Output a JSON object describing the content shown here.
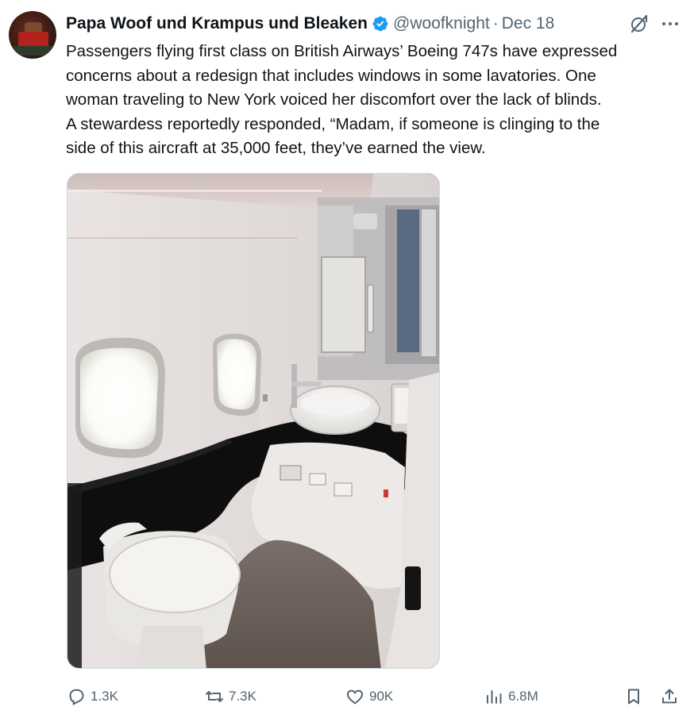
{
  "tweet": {
    "display_name": "Papa Woof und Krampus und Bleaken",
    "handle": "@woofknight",
    "separator": "·",
    "date": "Dec 18",
    "verified": true,
    "text": "Passengers flying first class on British Airways’ Boeing 747s have expressed\nconcerns about a redesign that includes windows in some lavatories. One\nwoman traveling to New York voiced her discomfort over the lack of blinds.\nA stewardess reportedly responded, “Madam, if someone is clinging to the\nside of this aircraft at 35,000 feet, they’ve earned the view."
  },
  "actions": {
    "replies": "1.3K",
    "reposts": "7.3K",
    "likes": "90K",
    "views": "6.8M"
  },
  "icons": {
    "verified": "verified-badge-icon",
    "grok": "grok-icon",
    "more": "more-icon",
    "reply": "reply-icon",
    "repost": "repost-icon",
    "like": "heart-icon",
    "views": "views-icon",
    "bookmark": "bookmark-icon",
    "share": "share-icon"
  },
  "colors": {
    "text": "#0f1419",
    "secondary": "#536471",
    "verified": "#1d9bf0",
    "border": "#cfd9de"
  }
}
